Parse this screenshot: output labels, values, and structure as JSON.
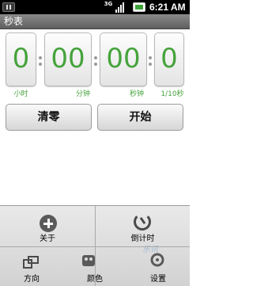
{
  "status_bar": {
    "network": "3G",
    "time": "6:21 AM",
    "battery_color": "#3da33a"
  },
  "title": "秒表",
  "digits": [
    {
      "value": "0",
      "unit": "小时"
    },
    {
      "value": "00",
      "unit": "分钟"
    },
    {
      "value": "00",
      "unit": "秒钟"
    },
    {
      "value": "0",
      "unit": "1/10秒"
    }
  ],
  "buttons": {
    "clear": "清零",
    "start": "开始"
  },
  "menu": {
    "about": "关于",
    "countdown": "倒计时",
    "direction": "方向",
    "color": "颜色",
    "settings": "设置"
  },
  "colors": {
    "digit": "#46a33c",
    "titlebar": "#6e6e6e"
  }
}
